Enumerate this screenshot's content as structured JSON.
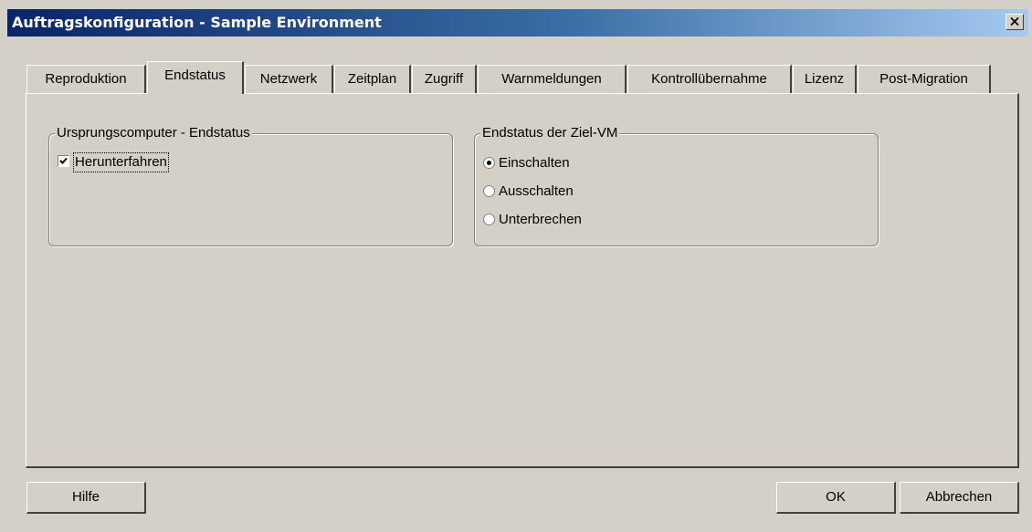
{
  "window": {
    "title": "Auftragskonfiguration - Sample Environment"
  },
  "tabs": [
    {
      "label": "Reproduktion",
      "active": false
    },
    {
      "label": "Endstatus",
      "active": true
    },
    {
      "label": "Netzwerk",
      "active": false
    },
    {
      "label": "Zeitplan",
      "active": false
    },
    {
      "label": "Zugriff",
      "active": false
    },
    {
      "label": "Warnmeldungen",
      "active": false
    },
    {
      "label": "Kontrollübernahme",
      "active": false
    },
    {
      "label": "Lizenz",
      "active": false
    },
    {
      "label": "Post-Migration",
      "active": false
    }
  ],
  "source_group": {
    "legend": "Ursprungscomputer - Endstatus",
    "shutdown": {
      "label": "Herunterfahren",
      "checked": true
    }
  },
  "target_group": {
    "legend": "Endstatus der Ziel-VM",
    "options": [
      {
        "label": "Einschalten",
        "selected": true
      },
      {
        "label": "Ausschalten",
        "selected": false
      },
      {
        "label": "Unterbrechen",
        "selected": false
      }
    ]
  },
  "buttons": {
    "help": "Hilfe",
    "ok": "OK",
    "cancel": "Abbrechen"
  }
}
